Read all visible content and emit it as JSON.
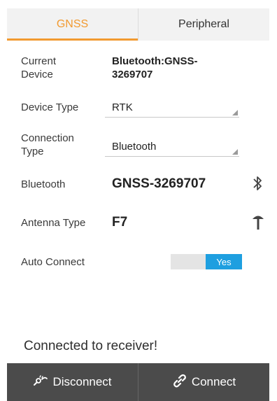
{
  "tabs": {
    "gnss": "GNSS",
    "peripheral": "Peripheral"
  },
  "form": {
    "current_device": {
      "label_line1": "Current",
      "label_line2": "Device",
      "value_line1": "Bluetooth:GNSS-",
      "value_line2": "3269707"
    },
    "device_type": {
      "label": "Device Type",
      "value": "RTK"
    },
    "connection_type": {
      "label_line1": "Connection",
      "label_line2": "Type",
      "value": "Bluetooth"
    },
    "bluetooth": {
      "label": "Bluetooth",
      "value": "GNSS-3269707",
      "icon": "bluetooth-icon"
    },
    "antenna_type": {
      "label": "Antenna Type",
      "value": "F7",
      "icon": "antenna-icon"
    },
    "auto_connect": {
      "label": "Auto Connect",
      "toggle_value": "Yes"
    }
  },
  "status_text": "Connected to receiver!",
  "bottom": {
    "disconnect": "Disconnect",
    "connect": "Connect"
  },
  "colors": {
    "accent": "#f29a30",
    "toggle_on": "#1e9fe0",
    "bottom_bar": "#4b4b4b"
  }
}
